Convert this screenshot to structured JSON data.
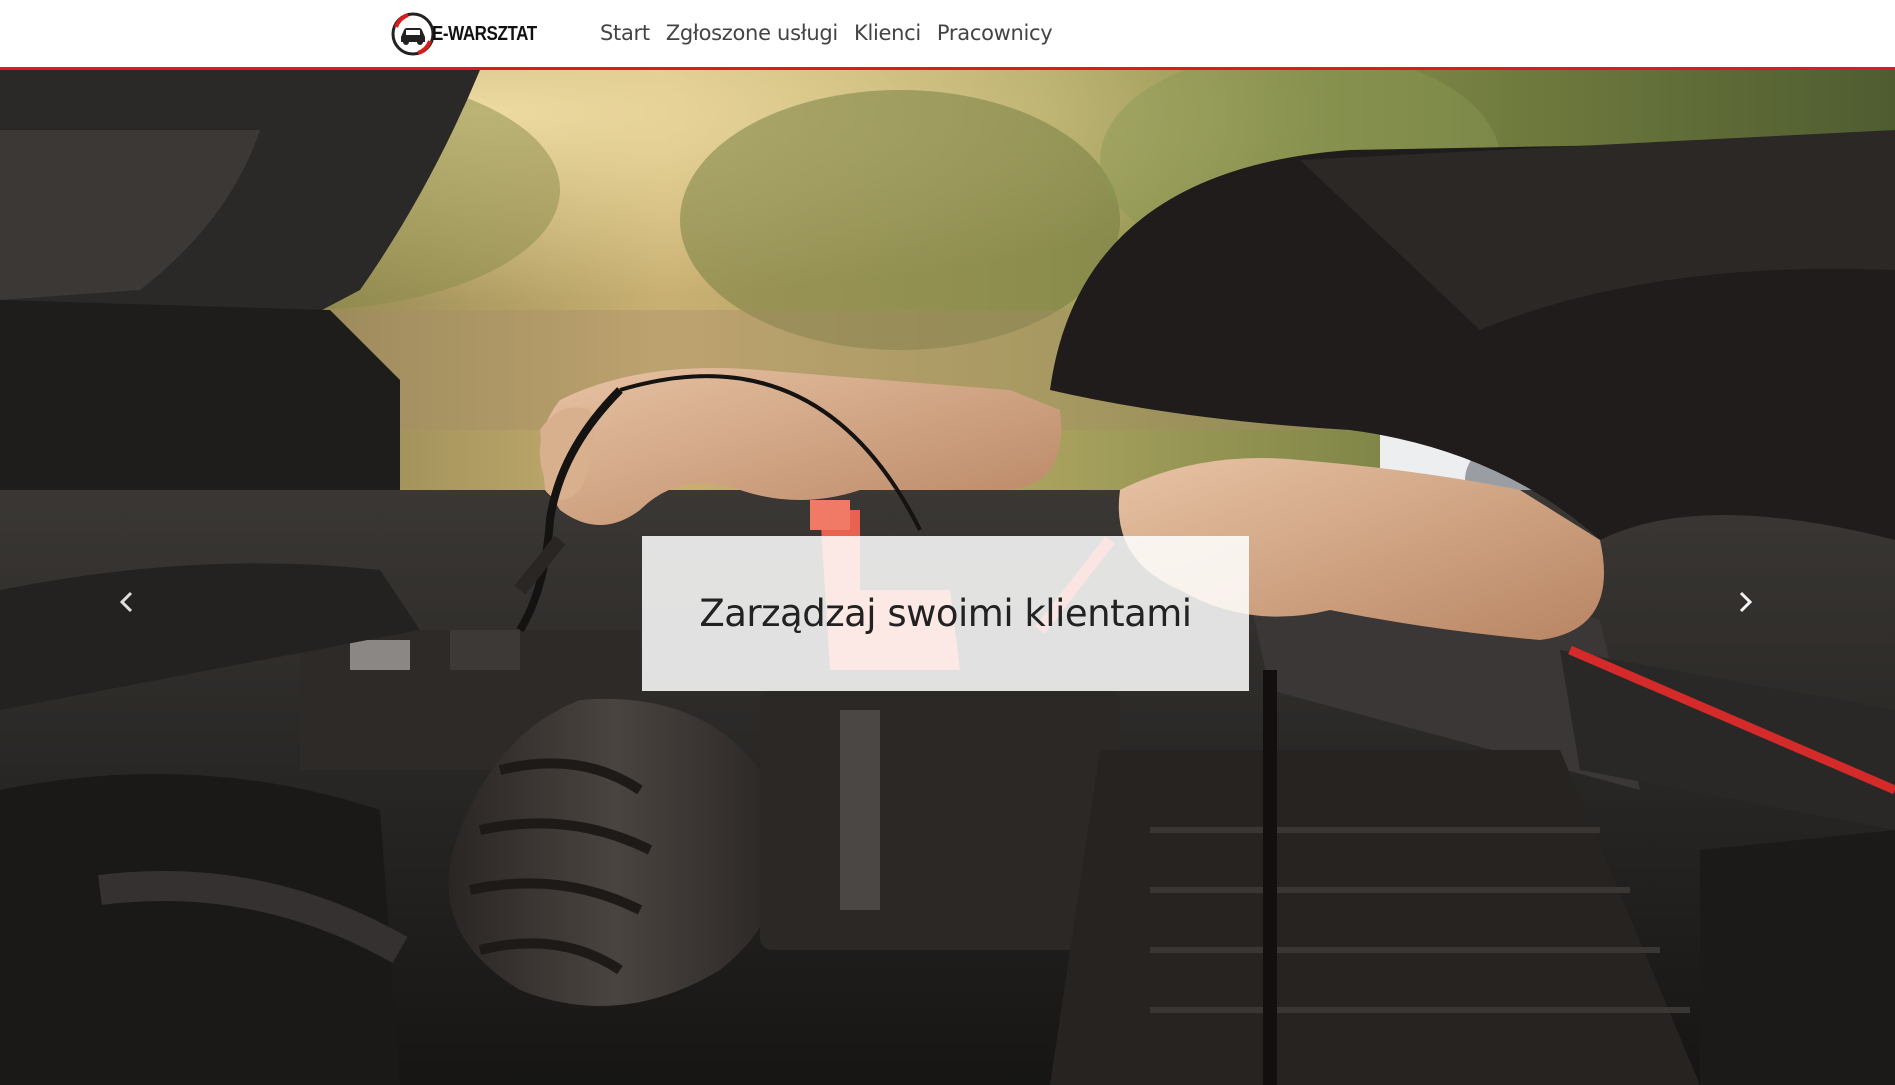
{
  "brand": {
    "name": "E-WARSZTAT",
    "logo_icon": "car-wrench-logo-icon",
    "accent_color": "#d91c1c"
  },
  "nav": {
    "items": [
      {
        "label": "Start"
      },
      {
        "label": "Zgłoszone usługi"
      },
      {
        "label": "Klienci"
      },
      {
        "label": "Pracownicy"
      }
    ]
  },
  "carousel": {
    "slide_image": "mechanic-engine-battery-photo",
    "caption": "Zarządzaj swoimi klientami",
    "prev_icon": "chevron-left-icon",
    "next_icon": "chevron-right-icon"
  }
}
